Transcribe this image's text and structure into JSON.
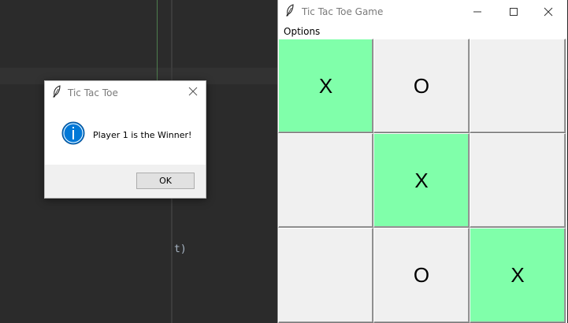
{
  "editor": {
    "code_fragment": "t)"
  },
  "message_box": {
    "title": "Tic Tac Toe",
    "icon": "info-icon",
    "message": "Player 1 is the Winner!",
    "ok_label": "OK"
  },
  "game_window": {
    "title": "Tic Tac Toe Game",
    "menu": [
      "Options"
    ],
    "board": [
      {
        "mark": "X",
        "winning": true
      },
      {
        "mark": "O",
        "winning": false
      },
      {
        "mark": "",
        "winning": false
      },
      {
        "mark": "",
        "winning": false
      },
      {
        "mark": "X",
        "winning": true
      },
      {
        "mark": "",
        "winning": false
      },
      {
        "mark": "",
        "winning": false
      },
      {
        "mark": "O",
        "winning": false
      },
      {
        "mark": "X",
        "winning": true
      }
    ]
  },
  "colors": {
    "win_cell": "#80ffaa",
    "info_icon": "#0078d7",
    "editor_bg": "#2b2b2b"
  }
}
